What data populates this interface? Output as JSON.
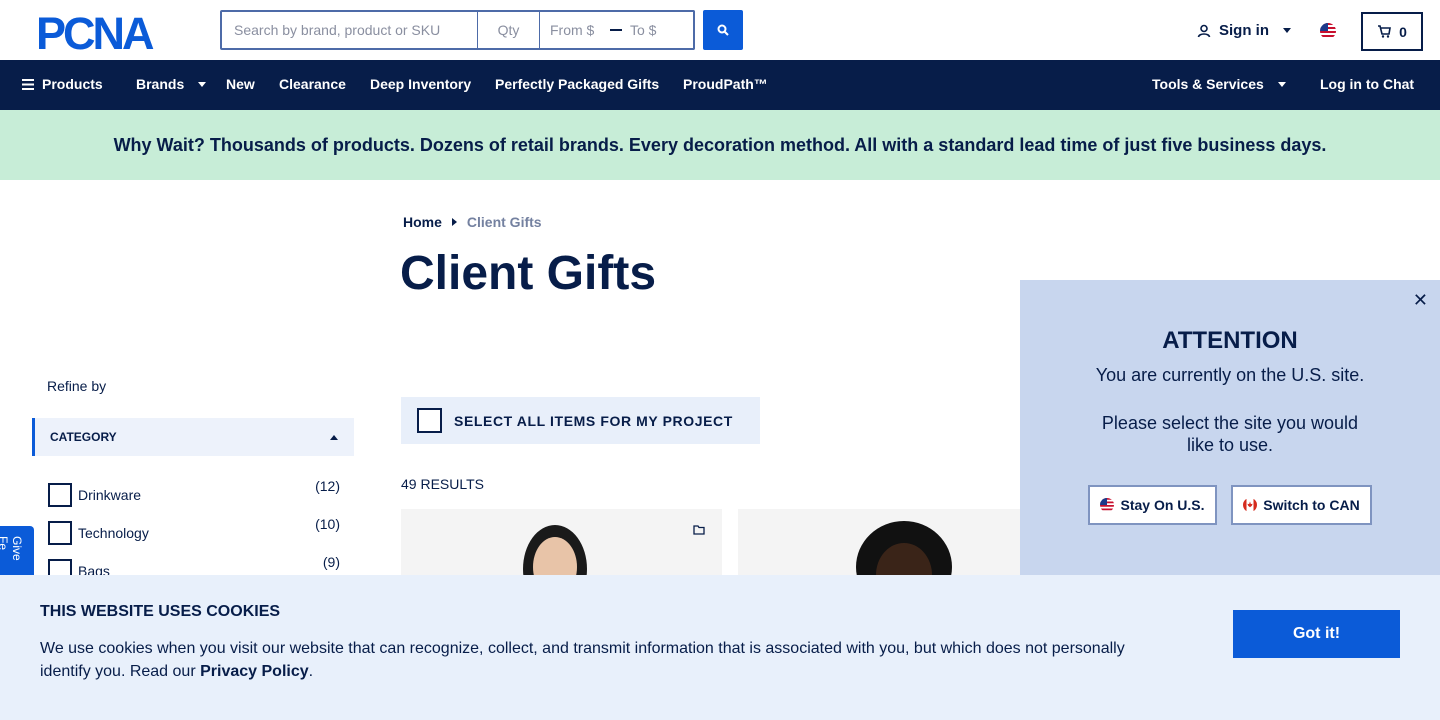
{
  "header": {
    "logo_text": "PCNA",
    "search_placeholder": "Search by brand, product or SKU",
    "qty_placeholder": "Qty",
    "price_from_placeholder": "From $",
    "price_to_placeholder": "To $",
    "sign_in_label": "Sign in",
    "cart_count": "0"
  },
  "nav": {
    "products": "Products",
    "brands": "Brands",
    "new": "New",
    "clearance": "Clearance",
    "deep_inventory": "Deep Inventory",
    "perfectly_packaged": "Perfectly Packaged Gifts",
    "proudpath": "ProudPath™",
    "tools": "Tools & Services",
    "chat": "Log in to Chat"
  },
  "banner": {
    "text": "Why Wait? Thousands of products. Dozens of retail brands. Every decoration method. All with a standard lead time of just five business days."
  },
  "breadcrumb": {
    "home": "Home",
    "current": "Client Gifts"
  },
  "page_title": "Client Gifts",
  "filters": {
    "refine_label": "Refine by",
    "category_header": "CATEGORY",
    "items": [
      {
        "label": "Drinkware",
        "count": "(12)"
      },
      {
        "label": "Technology",
        "count": "(10)"
      },
      {
        "label": "Bags",
        "count": "(9)"
      }
    ]
  },
  "results": {
    "select_all_label": "SELECT ALL ITEMS FOR MY PROJECT",
    "count_label": "49 RESULTS"
  },
  "feedback_tab": "Give Fe",
  "modal": {
    "title": "ATTENTION",
    "line1": "You are currently on the U.S. site.",
    "line2": "Please select the site you would like to use.",
    "stay_label": "Stay On U.S.",
    "switch_label": "Switch to CAN"
  },
  "cookie": {
    "title": "THIS WEBSITE USES COOKIES",
    "text": "We use cookies when you visit our website that can recognize, collect, and transmit information that is associated with you, but which does not personally identify you. Read our",
    "link": "Privacy Policy",
    "period": ".",
    "button": "Got it!"
  },
  "colors": {
    "navy": "#071d49",
    "blue": "#0b5bd8",
    "banner_green": "#c7edd7",
    "modal_bg": "#c8d6ee",
    "cookie_bg": "#e8f0fb"
  }
}
